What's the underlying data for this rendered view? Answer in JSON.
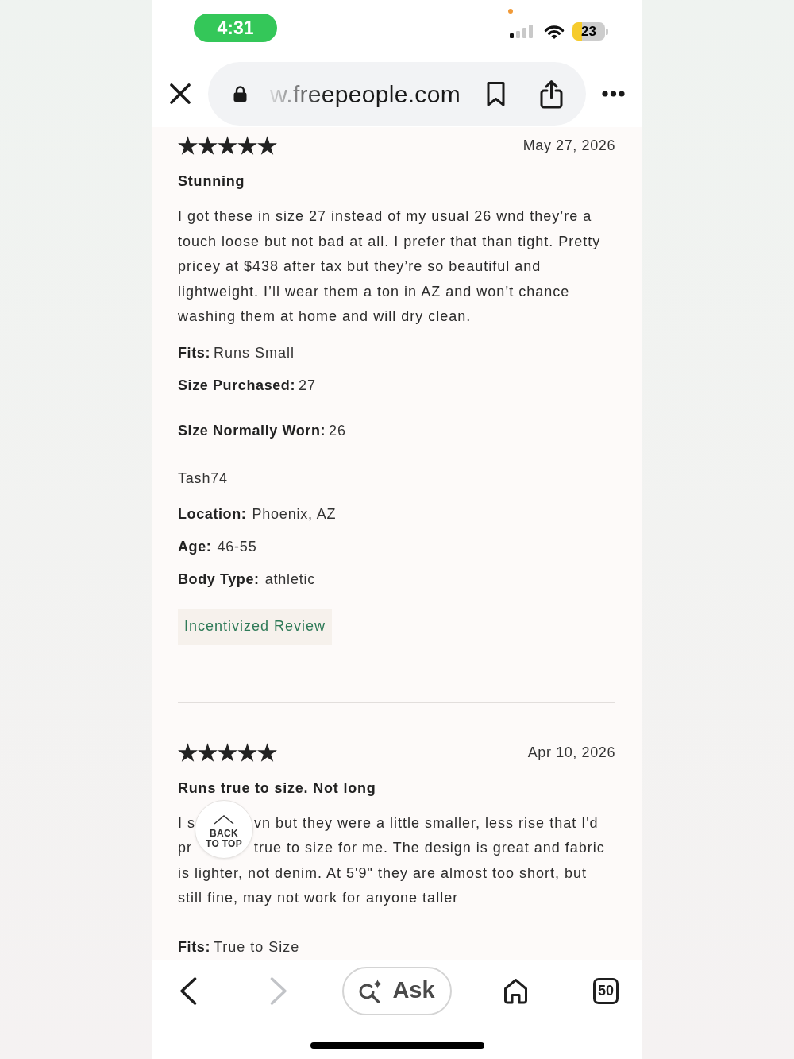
{
  "status_bar": {
    "time": "4:31",
    "battery": "23"
  },
  "browser": {
    "url": "w.freepeople.com"
  },
  "reviews": [
    {
      "stars": 5,
      "date": "May 27, 2026",
      "title": "Stunning",
      "body": "I got these in size 27 instead of my usual 26 wnd they’re a touch loose but not bad at all. I prefer that than tight. Pretty pricey at $438 after tax but they’re so beautiful and lightweight. I’ll wear them a ton in AZ and won’t chance washing them at home and will dry clean.",
      "details": [
        {
          "label": "Fits:",
          "value": "Runs Small"
        },
        {
          "label": "Size Purchased:",
          "value": "27"
        },
        {
          "label": "Size Normally Worn:",
          "value": "26"
        }
      ],
      "reviewer": "Tash74",
      "reviewer_info": [
        {
          "label": "Location:",
          "value": "Phoenix, AZ"
        },
        {
          "label": "Age:",
          "value": "46-55"
        },
        {
          "label": "Body Type:",
          "value": "athletic"
        }
      ],
      "badge": "Incentivized Review"
    },
    {
      "stars": 5,
      "date": "Apr 10, 2026",
      "title": "Runs true to size. Not long",
      "body_lines": [
        [
          "I s",
          "vn but they were a little smaller, less rise that I'd"
        ],
        [
          "pr",
          "true to size for me. The design is great and fabric"
        ],
        [
          "is lighter, not denim. At 5'9\" they are almost too short, but"
        ],
        [
          "still fine, may not work for anyone taller"
        ]
      ],
      "details": [
        {
          "label": "Fits:",
          "value": "True to Size"
        }
      ]
    }
  ],
  "back_to_top": "BACK TO TOP",
  "toolbar": {
    "back": {
      "disabled": false
    },
    "forward": {
      "disabled": true
    },
    "ask": "Ask",
    "tab_count": "50"
  }
}
